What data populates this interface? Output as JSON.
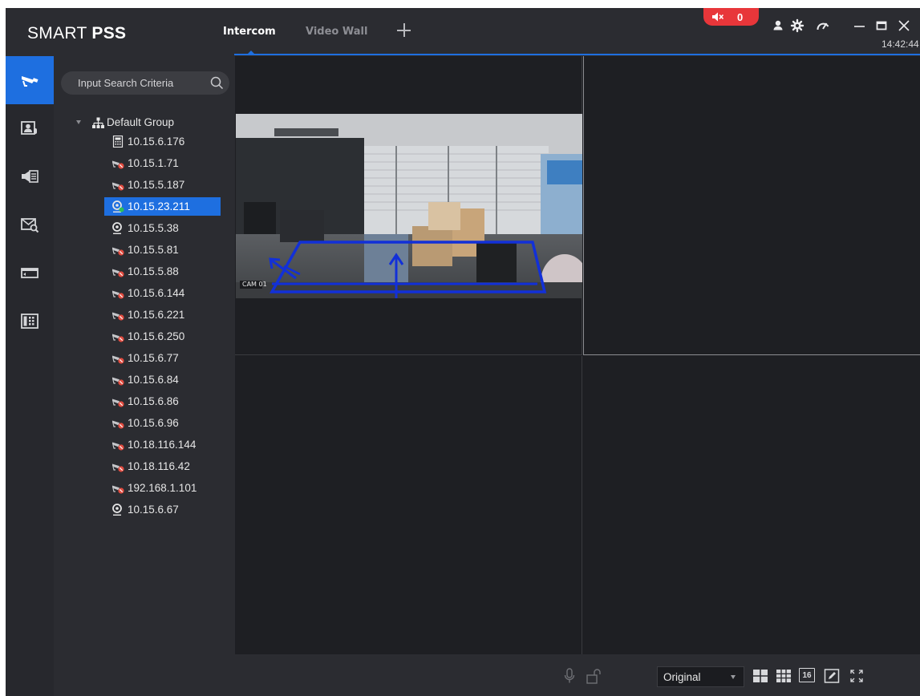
{
  "app": {
    "title_prefix": "SMART ",
    "title_bold": "PSS",
    "clock": "14:42:44"
  },
  "tabs": [
    {
      "label": "Intercom",
      "active": true
    },
    {
      "label": "Video Wall",
      "active": false
    }
  ],
  "header": {
    "alarm_count": "0",
    "icons": [
      "mute-speaker-icon",
      "user-icon",
      "settings-icon",
      "performance-icon",
      "minimize-icon",
      "maximize-icon",
      "close-icon"
    ]
  },
  "leftnav": {
    "items": [
      {
        "icon": "camera-icon",
        "active": true
      },
      {
        "icon": "contact-icon",
        "active": false
      },
      {
        "icon": "announcement-icon",
        "active": false
      },
      {
        "icon": "message-search-icon",
        "active": false
      },
      {
        "icon": "card-icon",
        "active": false
      },
      {
        "icon": "building-icon",
        "active": false
      }
    ]
  },
  "search": {
    "placeholder": "Input Search Criteria"
  },
  "tree": {
    "group_label": "Default Group",
    "devices": [
      {
        "ip": "10.15.6.176",
        "type": "door-station",
        "status": "online",
        "selected": false
      },
      {
        "ip": "10.15.1.71",
        "type": "camera",
        "status": "offline",
        "selected": false
      },
      {
        "ip": "10.15.5.187",
        "type": "camera",
        "status": "offline",
        "selected": false
      },
      {
        "ip": "10.15.23.211",
        "type": "webcam",
        "status": "online",
        "selected": true
      },
      {
        "ip": "10.15.5.38",
        "type": "webcam",
        "status": "online",
        "selected": false
      },
      {
        "ip": "10.15.5.81",
        "type": "camera",
        "status": "offline",
        "selected": false
      },
      {
        "ip": "10.15.5.88",
        "type": "camera",
        "status": "offline",
        "selected": false
      },
      {
        "ip": "10.15.6.144",
        "type": "camera",
        "status": "offline",
        "selected": false
      },
      {
        "ip": "10.15.6.221",
        "type": "camera",
        "status": "offline",
        "selected": false
      },
      {
        "ip": "10.15.6.250",
        "type": "camera",
        "status": "offline",
        "selected": false
      },
      {
        "ip": "10.15.6.77",
        "type": "camera",
        "status": "offline",
        "selected": false
      },
      {
        "ip": "10.15.6.84",
        "type": "camera",
        "status": "offline",
        "selected": false
      },
      {
        "ip": "10.15.6.86",
        "type": "camera",
        "status": "offline",
        "selected": false
      },
      {
        "ip": "10.15.6.96",
        "type": "camera",
        "status": "offline",
        "selected": false
      },
      {
        "ip": "10.18.116.144",
        "type": "camera",
        "status": "offline",
        "selected": false
      },
      {
        "ip": "10.18.116.42",
        "type": "camera",
        "status": "offline",
        "selected": false
      },
      {
        "ip": "192.168.1.101",
        "type": "camera",
        "status": "offline",
        "selected": false
      },
      {
        "ip": "10.15.6.67",
        "type": "webcam",
        "status": "online",
        "selected": false
      }
    ]
  },
  "video": {
    "cam_overlay_label": "CAM 01",
    "panes": [
      "live-feed",
      "empty",
      "empty",
      "empty"
    ]
  },
  "bottombar": {
    "ratio_value": "Original",
    "layout_16_label": "16",
    "icons": [
      "microphone-icon",
      "unlock-icon",
      "layout-4-icon",
      "layout-9-icon",
      "layout-16-icon",
      "edit-icon",
      "fullscreen-icon"
    ]
  },
  "colors": {
    "accent": "#1e6fe0",
    "alarm": "#e8363a",
    "offline": "#e24b3f",
    "online": "#2ec05a"
  }
}
